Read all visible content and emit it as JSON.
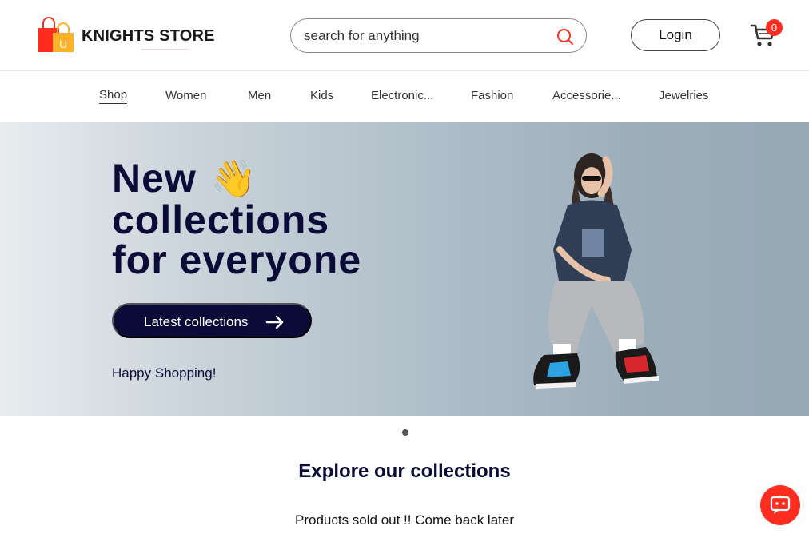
{
  "header": {
    "brand": "KNIGHTS STORE",
    "search_placeholder": "search for anything",
    "login_label": "Login",
    "cart_count": "0"
  },
  "nav": {
    "items": [
      "Shop",
      "Women",
      "Men",
      "Kids",
      "Electronic...",
      "Fashion",
      "Accessorie...",
      "Jewelries"
    ],
    "active": "Shop"
  },
  "hero": {
    "title_line1": "New",
    "title_line2": "collections",
    "title_line3": "for everyone",
    "wave_emoji": "👋",
    "cta_label": "Latest collections",
    "subtitle": "Happy Shopping!"
  },
  "collections": {
    "title": "Explore our collections",
    "empty_message": "Products sold out !! Come back later"
  },
  "colors": {
    "accent": "#ff2d20",
    "navy": "#0b0b38"
  }
}
